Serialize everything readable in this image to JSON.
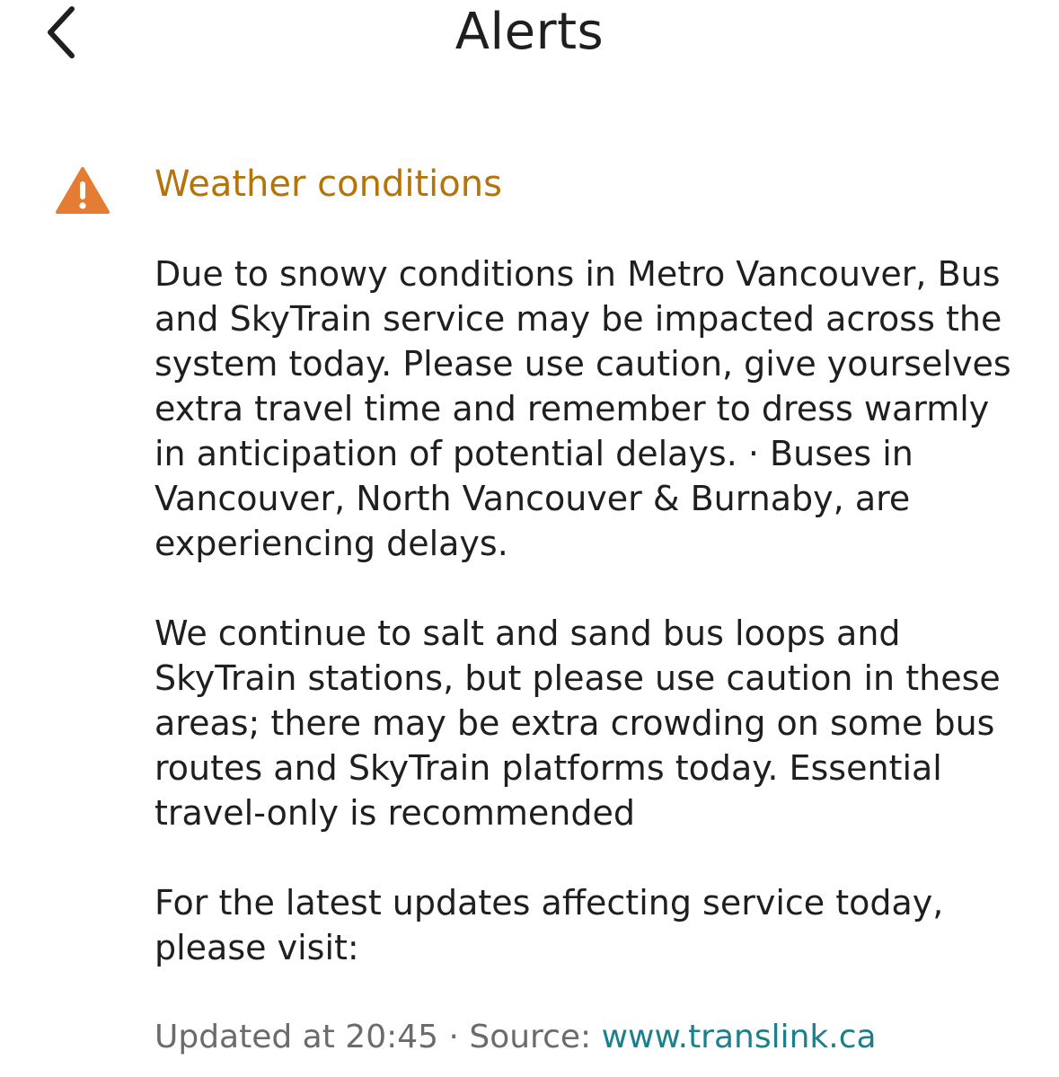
{
  "header": {
    "title": "Alerts",
    "back_icon": "chevron-left-icon"
  },
  "alert": {
    "icon": "warning-triangle-icon",
    "icon_color": "#E57C34",
    "title": "Weather conditions",
    "title_color": "#B5740A",
    "paragraphs": [
      "Due to snowy conditions in Metro Vancouver, Bus and SkyTrain service may be impacted across the system today. Please use caution, give yourselves extra travel time and remember to dress warmly in anticipation of potential delays. · Buses in Vancouver, North Vancouver & Burnaby, are experiencing delays.",
      "We continue to salt and sand bus loops and SkyTrain stations, but please use caution in these areas; there may be extra crowding on some bus routes and SkyTrain platforms today. Essential travel-only is recommended",
      "For the latest updates affecting service today, please visit:"
    ]
  },
  "footer": {
    "updated_label": "Updated at 20:45 · Source: ",
    "source_link": "www.translink.ca",
    "link_color": "#1B7F8C"
  }
}
